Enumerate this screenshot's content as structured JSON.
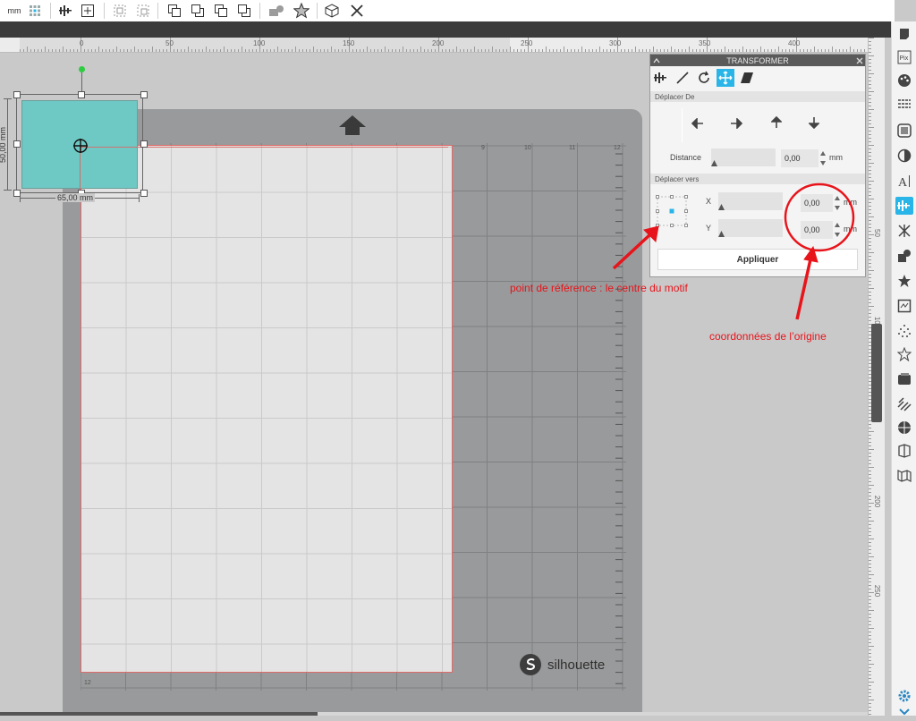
{
  "toolbar": {
    "unit_label": "mm"
  },
  "ruler": {
    "h_labels": [
      "0",
      "50",
      "100",
      "150",
      "200",
      "250",
      "300",
      "350",
      "400"
    ],
    "v_labels": [
      "50",
      "100",
      "150",
      "200",
      "250"
    ]
  },
  "shape": {
    "width_label": "65,00 mm",
    "height_label": "50,00 mm",
    "fill": "#6ec8c3"
  },
  "mat": {
    "brand": "silhouette",
    "grid_numbers": [
      "9",
      "10",
      "11",
      "12"
    ],
    "row_label": "12"
  },
  "transform_panel": {
    "title": "TRANSFORMER",
    "section_move_by": "Déplacer De",
    "distance_label": "Distance",
    "distance_value": "0,00",
    "distance_unit": "mm",
    "section_move_to": "Déplacer vers",
    "x_label": "X",
    "x_value": "0,00",
    "x_unit": "mm",
    "y_label": "Y",
    "y_value": "0,00",
    "y_unit": "mm",
    "apply_label": "Appliquer",
    "accent": "#29b5e8"
  },
  "annotations": {
    "reference_point": "point de référence : le centre du motif",
    "origin_coords": "coordonnées de l’origine",
    "color": "#e8141b"
  }
}
